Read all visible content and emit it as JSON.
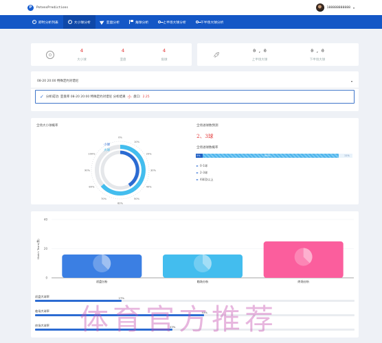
{
  "header": {
    "brand": "PotensPredictions",
    "brand_initial": "P",
    "username": "188888888888",
    "caret": "▾"
  },
  "nav": [
    {
      "label": "即时分析列表",
      "icon": "circle-icon"
    },
    {
      "label": "大小球分析",
      "icon": "target-icon"
    },
    {
      "label": "亚盘分析",
      "icon": "plane-icon"
    },
    {
      "label": "角球分析",
      "icon": "flag-icon"
    },
    {
      "label": "上半场大球分析",
      "icon": "key-icon"
    },
    {
      "label": "下半场大球分析",
      "icon": "key-icon"
    }
  ],
  "stats_left": {
    "icon": "soccer-ball-icon",
    "items": [
      {
        "value": "4",
        "label": "大小球"
      },
      {
        "value": "4",
        "label": "亚盘"
      },
      {
        "value": "4",
        "label": "角球"
      }
    ]
  },
  "stats_right": {
    "icon": "rocket-icon",
    "items": [
      {
        "value": "0 , 0",
        "label": "上半场大球"
      },
      {
        "value": "0 , 0",
        "label": "下半场大球"
      }
    ]
  },
  "analysis": {
    "selected_match": "08-20 20:00 特殊定约对谱尼",
    "result_prefix": "分析成功: 亚盘率 08-20 20:00 特殊定约对谱尼 分析结果",
    "result_pick": "小",
    "result_line_label": "盘口:",
    "result_line_value": "2.25"
  },
  "ou_panel": {
    "title": "全场大小球概率",
    "legend_small": "小球",
    "legend_big": "大球",
    "tick_labels": [
      "0%",
      "10%",
      "20%",
      "30%",
      "40%",
      "50%",
      "60%",
      "70%",
      "80%",
      "90%",
      "100%"
    ]
  },
  "goals_panel": {
    "title": "全场进球数预测",
    "prediction": "2、3球",
    "subtitle": "全场进球数概率",
    "bar_labels": [
      "5%",
      "84%",
      "11%"
    ],
    "legend": [
      "0-1球",
      "2-3球",
      "4球及以上"
    ]
  },
  "chart_data": {
    "type": "bar",
    "title": "",
    "ylabel": "Match Team(数)",
    "ylim": [
      0,
      40
    ],
    "yticks": [
      0,
      20,
      40
    ],
    "categories": [
      "初盘分析",
      "临场分析",
      "终场分析"
    ],
    "values": [
      16,
      16,
      25
    ],
    "colors": [
      "#3b7fe3",
      "#43bdee",
      "#fb5e9d"
    ]
  },
  "progress": [
    {
      "label": "初盘大球率",
      "value": 27,
      "text": "27%"
    },
    {
      "label": "临场大球率",
      "value": 53,
      "text": "53%"
    },
    {
      "label": "终场大球率",
      "value": 43,
      "text": "43%"
    }
  ],
  "colors": {
    "nav_bg": "#1457c6",
    "accent_red": "#e33c3c",
    "blue": "#2b6bd2",
    "cyan": "#43bdee",
    "pink": "#fb5e9d"
  },
  "watermark": "体育官方推荐"
}
